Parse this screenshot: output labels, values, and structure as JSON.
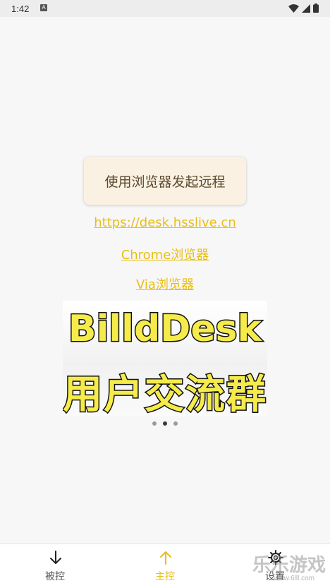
{
  "status_bar": {
    "time": "1:42",
    "notification_icon": "a-badge-icon",
    "icons": [
      "wifi-icon",
      "signal-icon",
      "battery-icon"
    ]
  },
  "main": {
    "remote_button_label": "使用浏览器发起远程",
    "links": {
      "url": "https://desk.hsslive.cn",
      "chrome": "Chrome浏览器",
      "via": "Via浏览器"
    },
    "banner": {
      "line1": "BilldDesk",
      "line2": "用户交流群"
    },
    "carousel": {
      "page_count": 3,
      "active_index": 1
    }
  },
  "bottom_nav": {
    "items": [
      {
        "label": "被控",
        "icon": "arrow-down-icon",
        "active": false
      },
      {
        "label": "主控",
        "icon": "arrow-up-icon",
        "active": true
      },
      {
        "label": "设置",
        "icon": "gear-icon",
        "active": false
      }
    ]
  },
  "watermark": {
    "title": "乐乐游戏",
    "site": "www.6lll.com"
  },
  "colors": {
    "accent": "#e9be12",
    "button_bg": "#fbf1e3",
    "banner_text": "#f5eb4a"
  }
}
